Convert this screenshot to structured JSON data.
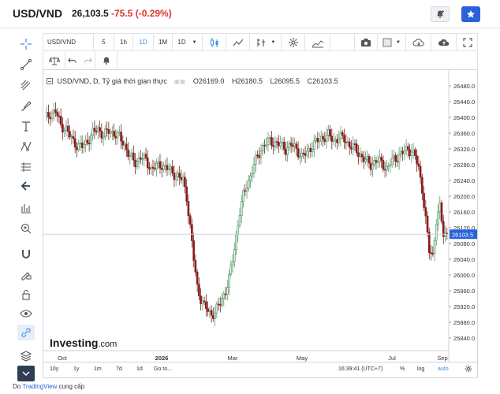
{
  "header": {
    "symbol": "USD/VND",
    "price": "26,103.5",
    "change": "-75.5",
    "change_pct": "(-0.29%)",
    "down_color": "#e0342f",
    "up_color": "#2e8b57",
    "alert_icon": "bell-plus-icon",
    "watchlist_icon": "star-icon"
  },
  "toolbar": {
    "symbol_input": "USD/VND",
    "intervals": [
      "5",
      "1h",
      "1D",
      "1M"
    ],
    "selected_interval": "1D",
    "chart_interval_select": "1D",
    "icons": [
      "candles-icon",
      "line-chart-icon",
      "indicators-icon",
      "settings-icon",
      "compare-icon",
      "camera-icon",
      "layout-icon",
      "cloud-download-icon",
      "cloud-upload-icon",
      "fullscreen-icon"
    ]
  },
  "toolbar2": {
    "icons": [
      "scales-icon",
      "undo-icon",
      "redo-icon",
      "alert-icon"
    ]
  },
  "left_tools": [
    "crosshair-icon",
    "trend-line-icon",
    "pitchfork-icon",
    "brush-icon",
    "text-icon",
    "pattern-icon",
    "prediction-icon",
    "back-arrow-icon",
    "fib-icon",
    "zoom-icon",
    "magnet-icon",
    "lock-draw-icon",
    "lock-icon",
    "eye-icon",
    "link-icon",
    "layers-icon",
    "collapse-icon"
  ],
  "legend": {
    "title": "USD/VND, D, Tỷ giá thời gian thực",
    "o_label": "O",
    "o": "26169.0",
    "h_label": "H",
    "h": "26180.5",
    "l_label": "L",
    "l": "26095.5",
    "c_label": "C",
    "c": "26103.5"
  },
  "watermark": {
    "brand": "Investing",
    "suffix": ".com"
  },
  "bottom": {
    "ranges": [
      "10y",
      "1y",
      "1m",
      "7d",
      "1d"
    ],
    "goto": "Go to...",
    "time": "16:39:41 (UTC+7)",
    "pct": "%",
    "log": "log",
    "auto": "auto"
  },
  "footer": {
    "prefix": "Do ",
    "link": "TradingView",
    "suffix": " cung cấp"
  },
  "chart_data": {
    "type": "candlestick",
    "x_ticks": [
      "Oct",
      "2026",
      "Mar",
      "May",
      "Jul",
      "Sep"
    ],
    "y_ticks": [
      "26480.0",
      "26440.0",
      "26400.0",
      "26360.0",
      "26320.0",
      "26280.0",
      "26240.0",
      "26200.0",
      "26160.0",
      "26120.0",
      "26080.0",
      "26040.0",
      "26000.0",
      "25960.0",
      "25920.0",
      "25880.0",
      "25840.0"
    ],
    "ylim": [
      25820,
      26500
    ],
    "last_price_label": "26103.5",
    "last_price": 26103.5,
    "close_path": [
      [
        0,
        26395
      ],
      [
        3,
        26410
      ],
      [
        6,
        26415
      ],
      [
        9,
        26380
      ],
      [
        12,
        26370
      ],
      [
        15,
        26345
      ],
      [
        18,
        26330
      ],
      [
        21,
        26325
      ],
      [
        24,
        26340
      ],
      [
        27,
        26360
      ],
      [
        30,
        26370
      ],
      [
        33,
        26355
      ],
      [
        36,
        26365
      ],
      [
        39,
        26360
      ],
      [
        42,
        26350
      ],
      [
        45,
        26330
      ],
      [
        48,
        26300
      ],
      [
        51,
        26285
      ],
      [
        54,
        26300
      ],
      [
        57,
        26290
      ],
      [
        60,
        26270
      ],
      [
        63,
        26275
      ],
      [
        66,
        26280
      ],
      [
        69,
        26270
      ],
      [
        72,
        26260
      ],
      [
        75,
        26250
      ],
      [
        78,
        26240
      ],
      [
        80,
        26200
      ],
      [
        82,
        26120
      ],
      [
        84,
        26040
      ],
      [
        86,
        25970
      ],
      [
        88,
        25940
      ],
      [
        90,
        25920
      ],
      [
        92,
        25910
      ],
      [
        94,
        25900
      ],
      [
        96,
        25905
      ],
      [
        98,
        25920
      ],
      [
        100,
        25940
      ],
      [
        102,
        25960
      ],
      [
        104,
        25990
      ],
      [
        106,
        26040
      ],
      [
        108,
        26100
      ],
      [
        110,
        26160
      ],
      [
        112,
        26200
      ],
      [
        114,
        26230
      ],
      [
        116,
        26250
      ],
      [
        118,
        26280
      ],
      [
        120,
        26300
      ],
      [
        122,
        26320
      ],
      [
        124,
        26330
      ],
      [
        127,
        26340
      ],
      [
        130,
        26335
      ],
      [
        133,
        26330
      ],
      [
        136,
        26320
      ],
      [
        139,
        26330
      ],
      [
        142,
        26320
      ],
      [
        145,
        26300
      ],
      [
        148,
        26310
      ],
      [
        151,
        26330
      ],
      [
        154,
        26340
      ],
      [
        157,
        26350
      ],
      [
        160,
        26355
      ],
      [
        163,
        26340
      ],
      [
        166,
        26350
      ],
      [
        169,
        26345
      ],
      [
        172,
        26330
      ],
      [
        175,
        26320
      ],
      [
        178,
        26305
      ],
      [
        181,
        26290
      ],
      [
        184,
        26280
      ],
      [
        187,
        26290
      ],
      [
        190,
        26285
      ],
      [
        193,
        26270
      ],
      [
        196,
        26290
      ],
      [
        199,
        26300
      ],
      [
        202,
        26310
      ],
      [
        205,
        26320
      ],
      [
        207,
        26315
      ],
      [
        209,
        26300
      ],
      [
        211,
        26270
      ],
      [
        213,
        26220
      ],
      [
        215,
        26140
      ],
      [
        217,
        26060
      ],
      [
        219,
        26050
      ],
      [
        221,
        26140
      ],
      [
        223,
        26170
      ],
      [
        225,
        26103
      ]
    ]
  }
}
